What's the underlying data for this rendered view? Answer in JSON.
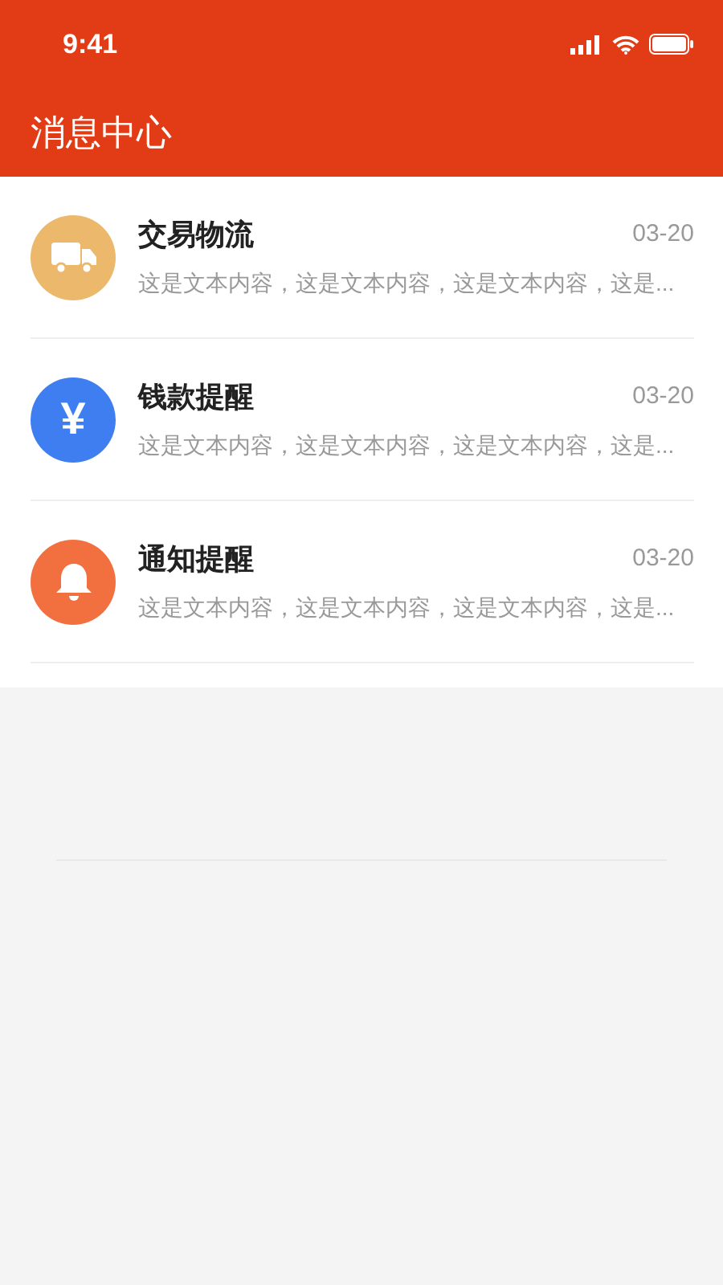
{
  "status_bar": {
    "time": "9:41"
  },
  "header": {
    "title": "消息中心"
  },
  "messages": [
    {
      "kind": "truck",
      "color": "#ebb86c",
      "title": "交易物流",
      "date": "03-20",
      "preview": "这是文本内容，这是文本内容，这是文本内容，这是..."
    },
    {
      "kind": "money",
      "color": "#3f7ef0",
      "symbol": "¥",
      "title": "钱款提醒",
      "date": "03-20",
      "preview": "这是文本内容，这是文本内容，这是文本内容，这是..."
    },
    {
      "kind": "bell",
      "color": "#f2703f",
      "title": "通知提醒",
      "date": "03-20",
      "preview": "这是文本内容，这是文本内容，这是文本内容，这是..."
    }
  ]
}
